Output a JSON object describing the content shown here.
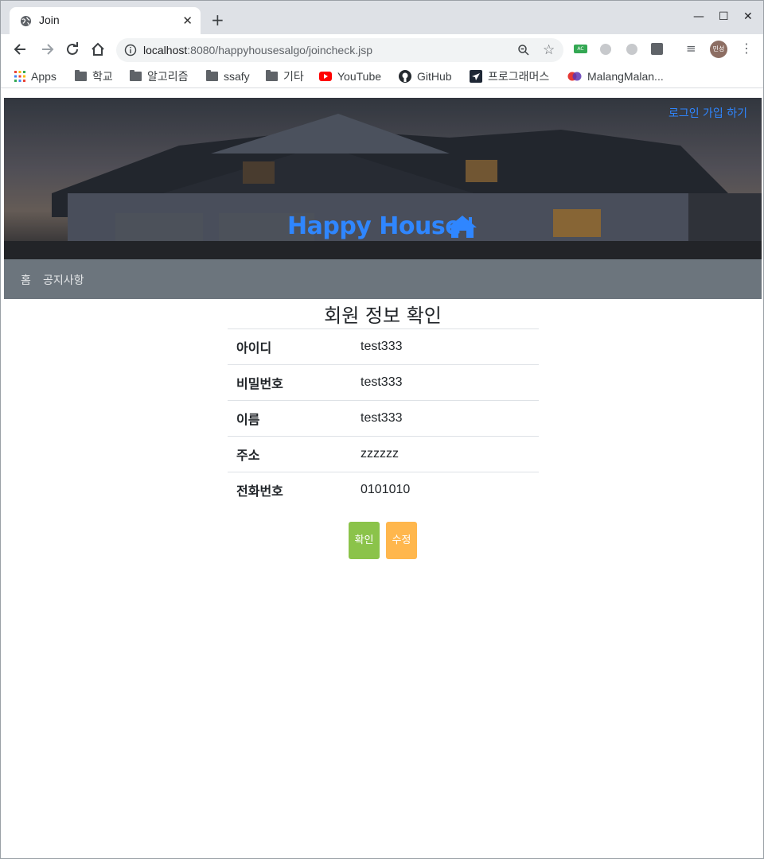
{
  "browser": {
    "tab_title": "Join",
    "url_host": "localhost",
    "url_rest": ":8080/happyhousesalgo/joincheck.jsp",
    "profile_initials": "민성",
    "bookmarks": [
      {
        "label": "Apps",
        "icon": "apps-grid-icon"
      },
      {
        "label": "학교",
        "icon": "folder-icon"
      },
      {
        "label": "알고리즘",
        "icon": "folder-icon"
      },
      {
        "label": "ssafy",
        "icon": "folder-icon"
      },
      {
        "label": "기타",
        "icon": "folder-icon"
      },
      {
        "label": "YouTube",
        "icon": "youtube-icon"
      },
      {
        "label": "GitHub",
        "icon": "github-icon"
      },
      {
        "label": "프로그래머스",
        "icon": "programmers-icon"
      },
      {
        "label": "MalangMalan...",
        "icon": "malang-icon"
      }
    ]
  },
  "header": {
    "auth_links": "로그인 가입 하기",
    "brand": "Happy House",
    "accent_color": "#2f86ff"
  },
  "nav": {
    "home": "홈",
    "notice": "공지사항"
  },
  "main": {
    "title": "회원 정보 확인",
    "rows": [
      {
        "label": "아이디",
        "value": "test333"
      },
      {
        "label": "비밀번호",
        "value": "test333"
      },
      {
        "label": "이름",
        "value": "test333"
      },
      {
        "label": "주소",
        "value": "zzzzzz"
      },
      {
        "label": "전화번호",
        "value": "0101010"
      }
    ],
    "confirm_label": "확인",
    "edit_label": "수정"
  }
}
